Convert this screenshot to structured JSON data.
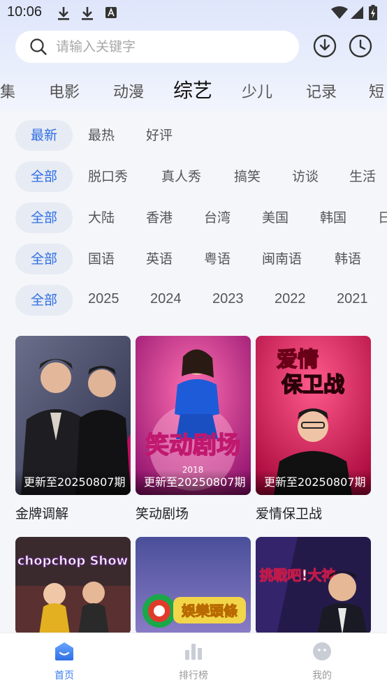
{
  "status_bar": {
    "time": "10:06",
    "icons": [
      "download-icon",
      "download-icon",
      "font-icon",
      "wifi-icon",
      "signal-icon",
      "battery-charging-icon"
    ]
  },
  "search": {
    "placeholder": "请输入关键字",
    "value": "",
    "icon": "search-icon"
  },
  "header_buttons": [
    "download-circle-icon",
    "history-clock-icon"
  ],
  "category_tabs": [
    "集",
    "电影",
    "动漫",
    "综艺",
    "少儿",
    "记录",
    "短"
  ],
  "active_category": "综艺",
  "filters": {
    "sort": [
      "最新",
      "最热",
      "好评"
    ],
    "genre": [
      "全部",
      "脱口秀",
      "真人秀",
      "搞笑",
      "访谈",
      "生活"
    ],
    "region": [
      "全部",
      "大陆",
      "香港",
      "台湾",
      "美国",
      "韩国",
      "日"
    ],
    "language": [
      "全部",
      "国语",
      "英语",
      "粤语",
      "闽南语",
      "韩语"
    ],
    "year": [
      "全部",
      "2025",
      "2024",
      "2023",
      "2022",
      "2021"
    ]
  },
  "cards": [
    {
      "title": "金牌调解",
      "update": "更新至20250807期"
    },
    {
      "title": "笑动剧场",
      "update": "更新至20250807期"
    },
    {
      "title": "爱情保卫战",
      "update": "更新至20250807期"
    },
    {
      "title": "",
      "update": ""
    },
    {
      "title": "",
      "update": ""
    },
    {
      "title": "",
      "update": ""
    }
  ],
  "poster_text": {
    "p2_logo": "笑动剧场",
    "p2_year": "2018",
    "p3_logo_top": "爱情",
    "p3_logo_bottom": "保卫战",
    "p4_logo": "chopchop Show",
    "p5_logo": "娛樂頭條",
    "p6_logo": "挑戰吧!大神"
  },
  "bottom_nav": [
    {
      "label": "首页",
      "icon": "home-icon",
      "active": true
    },
    {
      "label": "排行榜",
      "icon": "ranking-icon",
      "active": false
    },
    {
      "label": "我的",
      "icon": "profile-icon",
      "active": false
    }
  ],
  "colors": {
    "accent": "#2f6fe6",
    "chip_active_bg": "#e7ebf3",
    "nav_active": "#3a7bf0",
    "background": "#f4f6fa"
  }
}
